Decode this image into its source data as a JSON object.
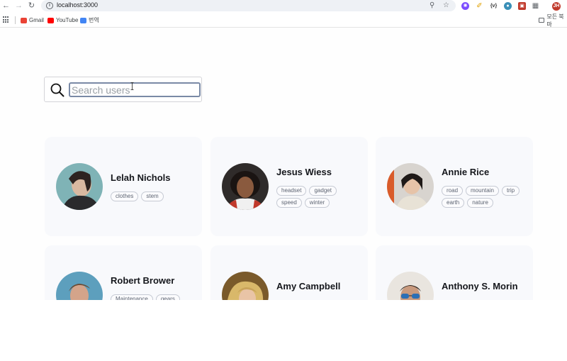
{
  "browser": {
    "url": "localhost:3000",
    "bookmarks": [
      {
        "label": "Gmail",
        "icon": "gmail-icon",
        "color": "#ea4335"
      },
      {
        "label": "YouTube",
        "icon": "youtube-icon",
        "color": "#ff0000"
      },
      {
        "label": "번역",
        "icon": "translate-icon",
        "color": "#4285f4"
      }
    ],
    "all_bookmarks_label": "모든 북마"
  },
  "search": {
    "placeholder": "Search users",
    "value": ""
  },
  "users": [
    {
      "name": "Lelah Nichols",
      "tags": [
        "clothes",
        "stem"
      ],
      "avatar_bg": "#7fb3b6"
    },
    {
      "name": "Jesus Wiess",
      "tags": [
        "headset",
        "gadget",
        "speed",
        "winter"
      ],
      "avatar_bg": "#2f2b2a"
    },
    {
      "name": "Annie Rice",
      "tags": [
        "road",
        "mountain",
        "trip",
        "earth",
        "nature"
      ],
      "avatar_bg": "#d8d4cf"
    },
    {
      "name": "Robert Brower",
      "tags": [
        "Maintenance",
        "gears"
      ],
      "avatar_bg": "#5d9fbd"
    },
    {
      "name": "Amy Campbell",
      "tags": [],
      "avatar_bg": "#7a5a2b"
    },
    {
      "name": "Anthony S. Morin",
      "tags": [],
      "avatar_bg": "#e9e5df"
    }
  ],
  "colors": {
    "card_bg": "#f8f9fc",
    "tag_border": "#c6cad4",
    "name_text": "#15171c"
  }
}
